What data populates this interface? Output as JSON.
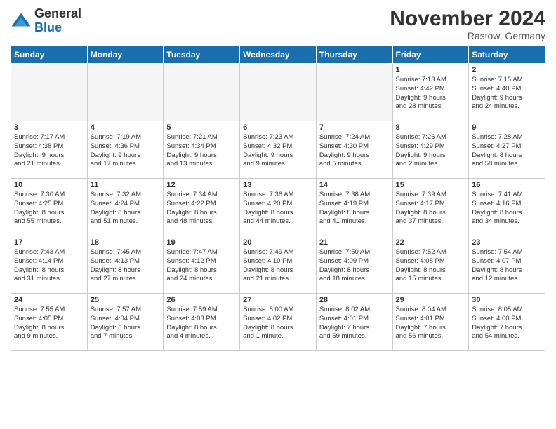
{
  "header": {
    "logo_line1": "General",
    "logo_line2": "Blue",
    "month_title": "November 2024",
    "location": "Rastow, Germany"
  },
  "weekdays": [
    "Sunday",
    "Monday",
    "Tuesday",
    "Wednesday",
    "Thursday",
    "Friday",
    "Saturday"
  ],
  "weeks": [
    [
      {
        "day": "",
        "info": ""
      },
      {
        "day": "",
        "info": ""
      },
      {
        "day": "",
        "info": ""
      },
      {
        "day": "",
        "info": ""
      },
      {
        "day": "",
        "info": ""
      },
      {
        "day": "1",
        "info": "Sunrise: 7:13 AM\nSunset: 4:42 PM\nDaylight: 9 hours\nand 28 minutes."
      },
      {
        "day": "2",
        "info": "Sunrise: 7:15 AM\nSunset: 4:40 PM\nDaylight: 9 hours\nand 24 minutes."
      }
    ],
    [
      {
        "day": "3",
        "info": "Sunrise: 7:17 AM\nSunset: 4:38 PM\nDaylight: 9 hours\nand 21 minutes."
      },
      {
        "day": "4",
        "info": "Sunrise: 7:19 AM\nSunset: 4:36 PM\nDaylight: 9 hours\nand 17 minutes."
      },
      {
        "day": "5",
        "info": "Sunrise: 7:21 AM\nSunset: 4:34 PM\nDaylight: 9 hours\nand 13 minutes."
      },
      {
        "day": "6",
        "info": "Sunrise: 7:23 AM\nSunset: 4:32 PM\nDaylight: 9 hours\nand 9 minutes."
      },
      {
        "day": "7",
        "info": "Sunrise: 7:24 AM\nSunset: 4:30 PM\nDaylight: 9 hours\nand 5 minutes."
      },
      {
        "day": "8",
        "info": "Sunrise: 7:26 AM\nSunset: 4:29 PM\nDaylight: 9 hours\nand 2 minutes."
      },
      {
        "day": "9",
        "info": "Sunrise: 7:28 AM\nSunset: 4:27 PM\nDaylight: 8 hours\nand 58 minutes."
      }
    ],
    [
      {
        "day": "10",
        "info": "Sunrise: 7:30 AM\nSunset: 4:25 PM\nDaylight: 8 hours\nand 55 minutes."
      },
      {
        "day": "11",
        "info": "Sunrise: 7:32 AM\nSunset: 4:24 PM\nDaylight: 8 hours\nand 51 minutes."
      },
      {
        "day": "12",
        "info": "Sunrise: 7:34 AM\nSunset: 4:22 PM\nDaylight: 8 hours\nand 48 minutes."
      },
      {
        "day": "13",
        "info": "Sunrise: 7:36 AM\nSunset: 4:20 PM\nDaylight: 8 hours\nand 44 minutes."
      },
      {
        "day": "14",
        "info": "Sunrise: 7:38 AM\nSunset: 4:19 PM\nDaylight: 8 hours\nand 41 minutes."
      },
      {
        "day": "15",
        "info": "Sunrise: 7:39 AM\nSunset: 4:17 PM\nDaylight: 8 hours\nand 37 minutes."
      },
      {
        "day": "16",
        "info": "Sunrise: 7:41 AM\nSunset: 4:16 PM\nDaylight: 8 hours\nand 34 minutes."
      }
    ],
    [
      {
        "day": "17",
        "info": "Sunrise: 7:43 AM\nSunset: 4:14 PM\nDaylight: 8 hours\nand 31 minutes."
      },
      {
        "day": "18",
        "info": "Sunrise: 7:45 AM\nSunset: 4:13 PM\nDaylight: 8 hours\nand 27 minutes."
      },
      {
        "day": "19",
        "info": "Sunrise: 7:47 AM\nSunset: 4:12 PM\nDaylight: 8 hours\nand 24 minutes."
      },
      {
        "day": "20",
        "info": "Sunrise: 7:49 AM\nSunset: 4:10 PM\nDaylight: 8 hours\nand 21 minutes."
      },
      {
        "day": "21",
        "info": "Sunrise: 7:50 AM\nSunset: 4:09 PM\nDaylight: 8 hours\nand 18 minutes."
      },
      {
        "day": "22",
        "info": "Sunrise: 7:52 AM\nSunset: 4:08 PM\nDaylight: 8 hours\nand 15 minutes."
      },
      {
        "day": "23",
        "info": "Sunrise: 7:54 AM\nSunset: 4:07 PM\nDaylight: 8 hours\nand 12 minutes."
      }
    ],
    [
      {
        "day": "24",
        "info": "Sunrise: 7:55 AM\nSunset: 4:05 PM\nDaylight: 8 hours\nand 9 minutes."
      },
      {
        "day": "25",
        "info": "Sunrise: 7:57 AM\nSunset: 4:04 PM\nDaylight: 8 hours\nand 7 minutes."
      },
      {
        "day": "26",
        "info": "Sunrise: 7:59 AM\nSunset: 4:03 PM\nDaylight: 8 hours\nand 4 minutes."
      },
      {
        "day": "27",
        "info": "Sunrise: 8:00 AM\nSunset: 4:02 PM\nDaylight: 8 hours\nand 1 minute."
      },
      {
        "day": "28",
        "info": "Sunrise: 8:02 AM\nSunset: 4:01 PM\nDaylight: 7 hours\nand 59 minutes."
      },
      {
        "day": "29",
        "info": "Sunrise: 8:04 AM\nSunset: 4:01 PM\nDaylight: 7 hours\nand 56 minutes."
      },
      {
        "day": "30",
        "info": "Sunrise: 8:05 AM\nSunset: 4:00 PM\nDaylight: 7 hours\nand 54 minutes."
      }
    ]
  ]
}
